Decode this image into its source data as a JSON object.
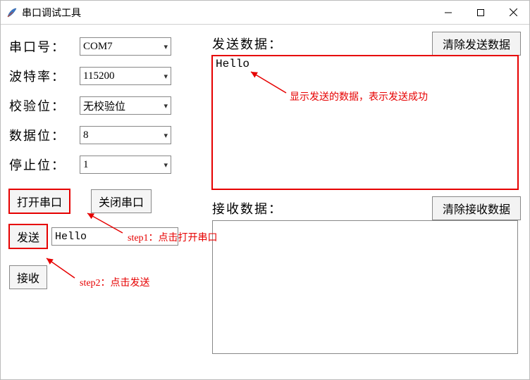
{
  "window": {
    "title": "串口调试工具"
  },
  "labels": {
    "port": "串口号：",
    "baud": "波特率：",
    "parity": "校验位：",
    "databits": "数据位：",
    "stopbits": "停止位：",
    "send_section": "发送数据：",
    "recv_section": "接收数据："
  },
  "combos": {
    "port": "COM7",
    "baud": "115200",
    "parity": "无校验位",
    "databits": "8",
    "stopbits": "1"
  },
  "buttons": {
    "open": "打开串口",
    "close": "关闭串口",
    "send": "发送",
    "recv": "接收",
    "clear_send": "清除发送数据",
    "clear_recv": "清除接收数据"
  },
  "fields": {
    "send_input": "Hello",
    "send_display": "Hello",
    "recv_display": ""
  },
  "annotations": {
    "step1": "step1：点击打开串口",
    "step2": "step2：点击发送",
    "sent_ok": "显示发送的数据，表示发送成功"
  },
  "colors": {
    "red": "#e60000"
  }
}
